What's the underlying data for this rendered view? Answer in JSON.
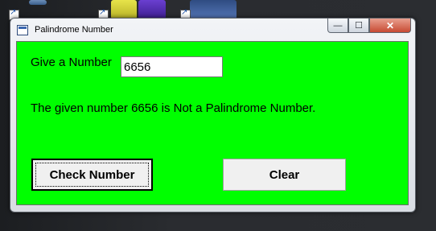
{
  "window": {
    "title": "Palindrome Number",
    "controls": {
      "minimize": "—",
      "maximize": "☐",
      "close": "✕"
    }
  },
  "form": {
    "prompt_label": "Give a Number",
    "number_value": "6656",
    "result_text": "The given number  6656 is Not a Palindrome Number.",
    "check_button": "Check Number",
    "clear_button": "Clear",
    "background_color": "#00ff00"
  }
}
